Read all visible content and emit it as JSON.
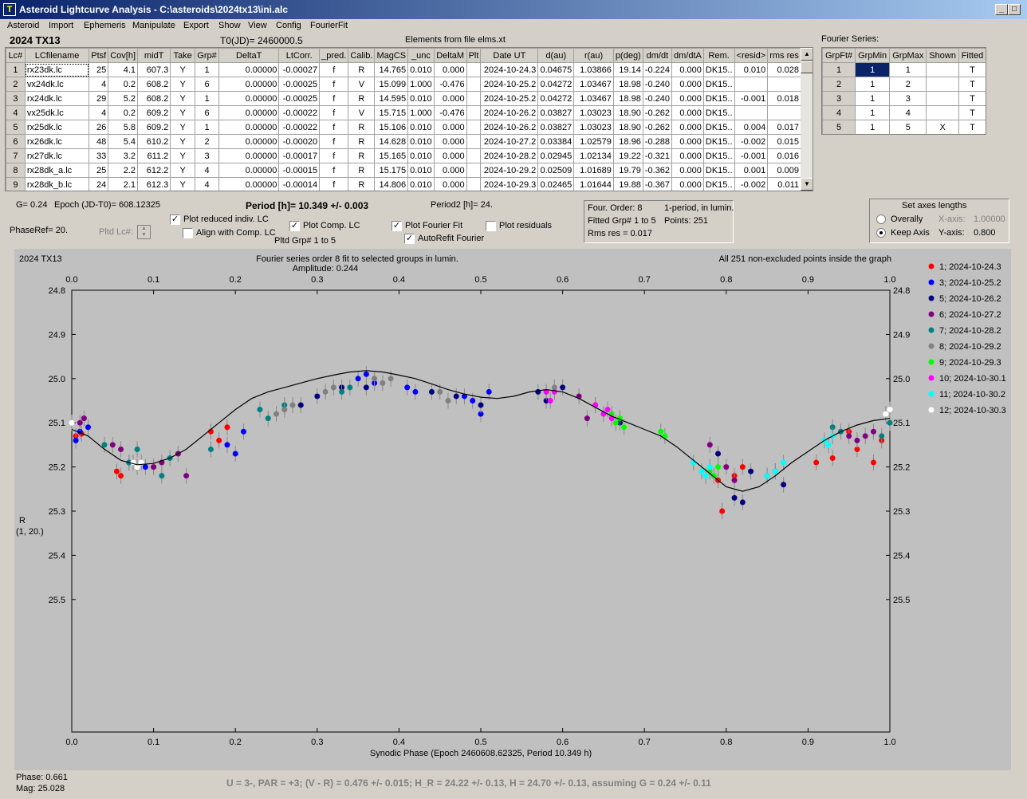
{
  "window": {
    "title": "Asteroid Lightcurve Analysis - C:\\asteroids\\2024tx13\\ini.alc",
    "icon": "app-icon",
    "min": "minimize-icon",
    "max": "maximize-icon",
    "close": "close-icon"
  },
  "menu": [
    "Asteroid",
    "Import",
    "Ephemeris",
    "Manipulate",
    "Export",
    "Show",
    "View",
    "Config",
    "FourierFit"
  ],
  "header": {
    "asteroid": "2024 TX13",
    "t0": "T0(JD)= 2460000.5",
    "elements": "Elements from file elms.xt"
  },
  "lc_table": {
    "columns": [
      "Lc#",
      "LCfilename",
      "Ptsf",
      "Cov[h]",
      "midT",
      "Take",
      "Grp#",
      "DeltaT",
      "LtCorr.",
      "_pred.",
      "Calib.",
      "MagCS",
      "_unc",
      "DeltaM",
      "Plt",
      "Date UT",
      "d(au)",
      "r(au)",
      "p(deg)",
      "dm/dt",
      "dm/dtA",
      "Rem.",
      "<resid>",
      "rms res"
    ],
    "rows": [
      [
        "1",
        "rx23dk.lc",
        "25",
        "4.1",
        "607.3",
        "Y",
        "1",
        "0.00000",
        "-0.00027",
        "f",
        "R",
        "14.765",
        "0.010",
        "0.000",
        "",
        "2024-10-24.3",
        "0.04675",
        "1.03866",
        "19.14",
        "-0.224",
        "0.000",
        "DK15..",
        "0.010",
        "0.028"
      ],
      [
        "2",
        "vx24dk.lc",
        "4",
        "0.2",
        "608.2",
        "Y",
        "6",
        "0.00000",
        "-0.00025",
        "f",
        "V",
        "15.099",
        "1.000",
        "-0.476",
        "",
        "2024-10-25.2",
        "0.04272",
        "1.03467",
        "18.98",
        "-0.240",
        "0.000",
        "DK15..",
        "",
        ""
      ],
      [
        "3",
        "rx24dk.lc",
        "29",
        "5.2",
        "608.2",
        "Y",
        "1",
        "0.00000",
        "-0.00025",
        "f",
        "R",
        "14.595",
        "0.010",
        "0.000",
        "",
        "2024-10-25.2",
        "0.04272",
        "1.03467",
        "18.98",
        "-0.240",
        "0.000",
        "DK15..",
        "-0.001",
        "0.018"
      ],
      [
        "4",
        "vx25dk.lc",
        "4",
        "0.2",
        "609.2",
        "Y",
        "6",
        "0.00000",
        "-0.00022",
        "f",
        "V",
        "15.715",
        "1.000",
        "-0.476",
        "",
        "2024-10-26.2",
        "0.03827",
        "1.03023",
        "18.90",
        "-0.262",
        "0.000",
        "DK15..",
        "",
        ""
      ],
      [
        "5",
        "rx25dk.lc",
        "26",
        "5.8",
        "609.2",
        "Y",
        "1",
        "0.00000",
        "-0.00022",
        "f",
        "R",
        "15.106",
        "0.010",
        "0.000",
        "",
        "2024-10-26.2",
        "0.03827",
        "1.03023",
        "18.90",
        "-0.262",
        "0.000",
        "DK15..",
        "0.004",
        "0.017"
      ],
      [
        "6",
        "rx26dk.lc",
        "48",
        "5.4",
        "610.2",
        "Y",
        "2",
        "0.00000",
        "-0.00020",
        "f",
        "R",
        "14.628",
        "0.010",
        "0.000",
        "",
        "2024-10-27.2",
        "0.03384",
        "1.02579",
        "18.96",
        "-0.288",
        "0.000",
        "DK15..",
        "-0.002",
        "0.015"
      ],
      [
        "7",
        "rx27dk.lc",
        "33",
        "3.2",
        "611.2",
        "Y",
        "3",
        "0.00000",
        "-0.00017",
        "f",
        "R",
        "15.165",
        "0.010",
        "0.000",
        "",
        "2024-10-28.2",
        "0.02945",
        "1.02134",
        "19.22",
        "-0.321",
        "0.000",
        "DK15..",
        "-0.001",
        "0.016"
      ],
      [
        "8",
        "rx28dk_a.lc",
        "25",
        "2.2",
        "612.2",
        "Y",
        "4",
        "0.00000",
        "-0.00015",
        "f",
        "R",
        "15.175",
        "0.010",
        "0.000",
        "",
        "2024-10-29.2",
        "0.02509",
        "1.01689",
        "19.79",
        "-0.362",
        "0.000",
        "DK15..",
        "0.001",
        "0.009"
      ],
      [
        "9",
        "rx28dk_b.lc",
        "24",
        "2.1",
        "612.3",
        "Y",
        "4",
        "0.00000",
        "-0.00014",
        "f",
        "R",
        "14.806",
        "0.010",
        "0.000",
        "",
        "2024-10-29.3",
        "0.02465",
        "1.01644",
        "19.88",
        "-0.367",
        "0.000",
        "DK15..",
        "-0.002",
        "0.011"
      ]
    ]
  },
  "fourier_table": {
    "label": "Fourier Series:",
    "columns": [
      "GrpFt#",
      "GrpMin",
      "GrpMax",
      "Shown",
      "Fitted"
    ],
    "rows": [
      [
        "1",
        "1",
        "1",
        "",
        "T"
      ],
      [
        "2",
        "1",
        "2",
        "",
        "T"
      ],
      [
        "3",
        "1",
        "3",
        "",
        "T"
      ],
      [
        "4",
        "1",
        "4",
        "",
        "T"
      ],
      [
        "5",
        "1",
        "5",
        "X",
        "T"
      ]
    ]
  },
  "controls": {
    "g": "G= 0.24",
    "epoch": "Epoch (JD-T0)= 608.12325",
    "period": "Period [h]= 10.349 +/- 0.003",
    "period2": "Period2 [h]= 24.",
    "phaseref": "PhaseRef= 20.",
    "pltd_lc": "Pltd Lc#:",
    "plot_reduced": "Plot reduced indiv. LC",
    "align_comp": "Align with Comp. LC",
    "plot_comp": "Plot Comp. LC",
    "pltd_grp": "Pltd Grp#  1  to  5",
    "plot_fourier": "Plot Fourier Fit",
    "autorefit": "AutoRefit Fourier",
    "plot_resid": "Plot residuals",
    "info1": "Four. Order:  8",
    "info2": "1-period, in lumin.",
    "info3": "Fitted Grp# 1 to 5",
    "info4": "Points: 251",
    "info5": "Rms res      = 0.017",
    "axes_title": "Set axes lengths",
    "overally": "Overally",
    "keep_axis": "Keep Axis",
    "xaxis": "X-axis:",
    "xval": "1.00000",
    "yaxis": "Y-axis:",
    "yval": "0.800"
  },
  "footer": {
    "phase": "Phase:  0.661",
    "mag": "Mag:    25.028",
    "summary": "U = 3-, PAR = +3; (V - R) = 0.476 +/- 0.015; H_R = 24.22 +/- 0.13, H = 24.70 +/- 0.13, assuming G = 0.24 +/- 0.11"
  },
  "chart_data": {
    "type": "scatter",
    "object": "2024 TX13",
    "title": "Fourier series order 8 fit to selected groups in lumin.",
    "subtitle": "Amplitude: 0.244",
    "note": "All 251 non-excluded points inside the graph",
    "xlabel": "Synodic Phase (Epoch 2460608.62325, Period 10.349 h)",
    "ylabel": "R",
    "ylabel2": "(1, 20.)",
    "xlim": [
      0,
      1
    ],
    "ylim": [
      25.8,
      24.8
    ],
    "xticks": [
      "0.0",
      "0.1",
      "0.2",
      "0.3",
      "0.4",
      "0.5",
      "0.6",
      "0.7",
      "0.8",
      "0.9",
      "1.0"
    ],
    "yticks": [
      "24.8",
      "24.9",
      "25.0",
      "25.1",
      "25.2",
      "25.3",
      "25.4",
      "25.5"
    ],
    "fit_curve": {
      "x": [
        0,
        0.02,
        0.04,
        0.06,
        0.08,
        0.1,
        0.12,
        0.14,
        0.16,
        0.18,
        0.2,
        0.22,
        0.24,
        0.26,
        0.28,
        0.3,
        0.32,
        0.34,
        0.36,
        0.38,
        0.4,
        0.42,
        0.44,
        0.46,
        0.48,
        0.5,
        0.52,
        0.54,
        0.56,
        0.58,
        0.6,
        0.62,
        0.64,
        0.66,
        0.68,
        0.7,
        0.72,
        0.74,
        0.76,
        0.78,
        0.8,
        0.82,
        0.84,
        0.86,
        0.88,
        0.9,
        0.92,
        0.94,
        0.96,
        0.98,
        1.0
      ],
      "y": [
        25.115,
        25.13,
        25.16,
        25.185,
        25.195,
        25.192,
        25.18,
        25.16,
        25.13,
        25.1,
        25.07,
        25.045,
        25.03,
        25.02,
        25.01,
        25.0,
        24.992,
        24.985,
        24.982,
        24.985,
        24.992,
        25.0,
        25.012,
        25.025,
        25.035,
        25.042,
        25.045,
        25.04,
        25.03,
        25.025,
        25.03,
        25.045,
        25.065,
        25.085,
        25.1,
        25.115,
        25.13,
        25.155,
        25.185,
        25.215,
        25.245,
        25.255,
        25.245,
        25.22,
        25.19,
        25.165,
        25.14,
        25.12,
        25.105,
        25.095,
        25.09
      ]
    },
    "series": [
      {
        "name": "1; 2024-10-24.3",
        "color": "#ff0000",
        "x": [
          0.005,
          0.012,
          0.055,
          0.06,
          0.1,
          0.17,
          0.18,
          0.19,
          0.91,
          0.93,
          0.95,
          0.96,
          0.98,
          0.99,
          0.79,
          0.795,
          0.81,
          0.82
        ],
        "y": [
          25.13,
          25.125,
          25.21,
          25.22,
          25.2,
          25.12,
          25.14,
          25.11,
          25.19,
          25.18,
          25.12,
          25.16,
          25.19,
          25.14,
          25.23,
          25.3,
          25.22,
          25.2
        ]
      },
      {
        "name": "3; 2024-10-25.2",
        "color": "#0000ff",
        "x": [
          0.005,
          0.01,
          0.02,
          0.07,
          0.09,
          0.19,
          0.2,
          0.21,
          0.35,
          0.36,
          0.37,
          0.41,
          0.42,
          0.48,
          0.49,
          0.5,
          0.51
        ],
        "y": [
          25.14,
          25.12,
          25.11,
          25.19,
          25.2,
          25.15,
          25.17,
          25.12,
          25.0,
          24.99,
          25.01,
          25.02,
          25.03,
          25.04,
          25.05,
          25.08,
          25.03
        ]
      },
      {
        "name": "5; 2024-10-26.2",
        "color": "#000080",
        "x": [
          0.28,
          0.3,
          0.33,
          0.36,
          0.44,
          0.47,
          0.5,
          0.57,
          0.58,
          0.6,
          0.67,
          0.79,
          0.81,
          0.82,
          0.83,
          0.87
        ],
        "y": [
          25.06,
          25.04,
          25.02,
          25.02,
          25.03,
          25.04,
          25.06,
          25.03,
          25.05,
          25.02,
          25.1,
          25.17,
          25.27,
          25.28,
          25.21,
          25.24
        ]
      },
      {
        "name": "6; 2024-10-27.2",
        "color": "#800080",
        "x": [
          0.01,
          0.015,
          0.05,
          0.06,
          0.1,
          0.11,
          0.13,
          0.14,
          0.62,
          0.63,
          0.64,
          0.78,
          0.8,
          0.81,
          0.85,
          0.86,
          0.95,
          0.96,
          0.97,
          0.98
        ],
        "y": [
          25.1,
          25.09,
          25.15,
          25.16,
          25.2,
          25.19,
          25.17,
          25.22,
          25.04,
          25.09,
          25.06,
          25.15,
          25.2,
          25.23,
          25.22,
          25.21,
          25.13,
          25.14,
          25.13,
          25.12
        ]
      },
      {
        "name": "7; 2024-10-28.2",
        "color": "#008080",
        "x": [
          0.04,
          0.07,
          0.08,
          0.11,
          0.12,
          0.17,
          0.23,
          0.24,
          0.26,
          0.33,
          0.34,
          0.93,
          0.94,
          0.99,
          1.0
        ],
        "y": [
          25.15,
          25.19,
          25.16,
          25.22,
          25.18,
          25.16,
          25.07,
          25.09,
          25.06,
          25.03,
          25.02,
          25.11,
          25.12,
          25.13,
          25.1
        ]
      },
      {
        "name": "8; 2024-10-29.2",
        "color": "#808080",
        "x": [
          0.25,
          0.26,
          0.27,
          0.31,
          0.32,
          0.37,
          0.38,
          0.39,
          0.45,
          0.46,
          0.58,
          0.59
        ],
        "y": [
          25.08,
          25.07,
          25.06,
          25.03,
          25.02,
          25.0,
          25.01,
          25.0,
          25.03,
          25.05,
          25.03,
          25.02
        ]
      },
      {
        "name": "9; 2024-10-29.3",
        "color": "#00ff00",
        "x": [
          0.66,
          0.665,
          0.67,
          0.675,
          0.72,
          0.725,
          0.78,
          0.785,
          0.79
        ],
        "y": [
          25.08,
          25.1,
          25.09,
          25.11,
          25.12,
          25.13,
          25.21,
          25.22,
          25.2
        ]
      },
      {
        "name": "10; 2024-10-30.1",
        "color": "#ff00ff",
        "x": [
          0.58,
          0.585,
          0.59,
          0.64,
          0.65,
          0.655,
          0.66
        ],
        "y": [
          25.03,
          25.05,
          25.03,
          25.06,
          25.08,
          25.07,
          25.09
        ]
      },
      {
        "name": "11; 2024-10-30.2",
        "color": "#00ffff",
        "x": [
          0.76,
          0.77,
          0.775,
          0.78,
          0.85,
          0.86,
          0.87,
          0.92,
          0.925,
          0.93
        ],
        "y": [
          25.19,
          25.21,
          25.22,
          25.2,
          25.22,
          25.21,
          25.19,
          25.14,
          25.15,
          25.13
        ]
      },
      {
        "name": "12; 2024-10-30.3",
        "color": "#ffffff",
        "x": [
          0.0,
          0.075,
          0.08,
          0.085,
          1.0,
          0.995
        ],
        "y": [
          25.1,
          25.19,
          25.2,
          25.19,
          25.07,
          25.08
        ]
      }
    ]
  }
}
